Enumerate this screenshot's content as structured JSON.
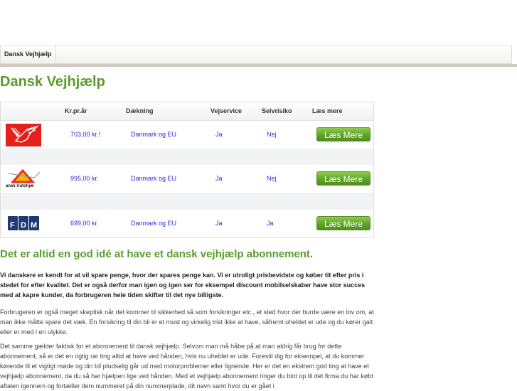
{
  "nav": {
    "items": [
      {
        "label": "Dansk Vejhjælp"
      }
    ]
  },
  "title": "Dansk Vejhjælp",
  "table": {
    "headers": [
      "Kr.pr.år",
      "Dækning",
      "Vejservice",
      "Selvrisiko",
      "Læs mere"
    ],
    "rows": [
      {
        "logo": "falck-logo",
        "logo_text": "",
        "price": "703,00 kr.!",
        "coverage": "Danmark og EU",
        "roadservice": "Ja",
        "deductible": "Nej",
        "button": "Læs Mere"
      },
      {
        "logo": "dansk-autohjaelp-logo",
        "logo_text": "ansk Autohjæ",
        "price": "995,00 kr.",
        "coverage": "Danmark og EU",
        "roadservice": "Ja",
        "deductible": "Nej",
        "button": "Læs Mere"
      },
      {
        "logo": "fdm-logo",
        "logo_text": "FDM",
        "price": "699,00 kr.",
        "coverage": "Danmark og EU",
        "roadservice": "Ja",
        "deductible": "Ja",
        "button": "Læs Mere"
      }
    ]
  },
  "heading": "Det er altid en god idé at have et dansk vejhjælp abonnement.",
  "paragraphs": [
    "Vi danskere er kendt for at vil spare penge, hvor der spares penge kan. Vi er utroligt prisbevidste og køber tit efter pris i stedet for efter kvalitet. Det er også derfor man igen og igen ser for eksempel discount mobilselskaber have stor succes med at kapre kunder, da forbrugeren hele tiden skifter til det nye billigste.",
    "Forbrugeren er også meget skeptisk når det kommer til sikkerhed så som forsikringer etc., et sted hvor der burde være en lov om, at man ikke måtte spare det væk. En forsikring til din bil er et must og virkelig trist ikke at have, såfremt uheldet er ude og du kører galt eller er med i en ulykke.",
    "Det samme gælder faktisk for et abonnement til dansk vejhjælp. Selvom man må håbe på at man aldrig får brug for dette abonnement, så er det en rigtig rar ting altid at have ved hånden, hvis nu uheldet er ude. Forestil dig for eksempel, at du kommer kørende til et vigtigt møde og din bil pludselig går ud med motorproblemer eller lignende. Her er det en ekstrem god ting at have et vejhjælp abonnement, da du så har hjælpen lige ved hånden. Med et vejhjælp abonnement ringer du blot op til det firma du har købt aftalen igennem og fortæller dem nummeret på din nummerplade, dit navn samt hvor du er gået i"
  ]
}
